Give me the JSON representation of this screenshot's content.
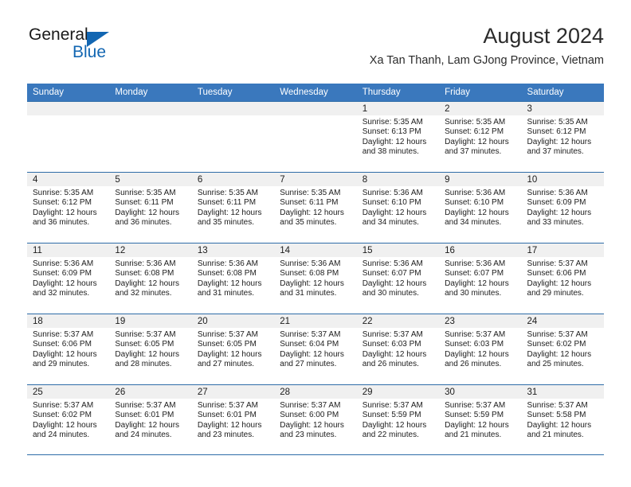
{
  "logo": {
    "primary_text": "General",
    "secondary_text": "Blue",
    "triangle_color": "#1266b2",
    "blue_color": "#1266b2"
  },
  "header": {
    "title": "August 2024",
    "subtitle": "Xa Tan Thanh, Lam GJong Province, Vietnam"
  },
  "theme": {
    "header_bar_color": "#3a78bd",
    "row_border_color": "#2e6da8",
    "day_number_band_color": "#f0f0f0"
  },
  "weekdays": [
    "Sunday",
    "Monday",
    "Tuesday",
    "Wednesday",
    "Thursday",
    "Friday",
    "Saturday"
  ],
  "weeks": [
    [
      {
        "day": "",
        "empty": true
      },
      {
        "day": "",
        "empty": true
      },
      {
        "day": "",
        "empty": true
      },
      {
        "day": "",
        "empty": true
      },
      {
        "day": "1",
        "sunrise": "Sunrise: 5:35 AM",
        "sunset": "Sunset: 6:13 PM",
        "daylight_line1": "Daylight: 12 hours",
        "daylight_line2": "and 38 minutes."
      },
      {
        "day": "2",
        "sunrise": "Sunrise: 5:35 AM",
        "sunset": "Sunset: 6:12 PM",
        "daylight_line1": "Daylight: 12 hours",
        "daylight_line2": "and 37 minutes."
      },
      {
        "day": "3",
        "sunrise": "Sunrise: 5:35 AM",
        "sunset": "Sunset: 6:12 PM",
        "daylight_line1": "Daylight: 12 hours",
        "daylight_line2": "and 37 minutes."
      }
    ],
    [
      {
        "day": "4",
        "sunrise": "Sunrise: 5:35 AM",
        "sunset": "Sunset: 6:12 PM",
        "daylight_line1": "Daylight: 12 hours",
        "daylight_line2": "and 36 minutes."
      },
      {
        "day": "5",
        "sunrise": "Sunrise: 5:35 AM",
        "sunset": "Sunset: 6:11 PM",
        "daylight_line1": "Daylight: 12 hours",
        "daylight_line2": "and 36 minutes."
      },
      {
        "day": "6",
        "sunrise": "Sunrise: 5:35 AM",
        "sunset": "Sunset: 6:11 PM",
        "daylight_line1": "Daylight: 12 hours",
        "daylight_line2": "and 35 minutes."
      },
      {
        "day": "7",
        "sunrise": "Sunrise: 5:35 AM",
        "sunset": "Sunset: 6:11 PM",
        "daylight_line1": "Daylight: 12 hours",
        "daylight_line2": "and 35 minutes."
      },
      {
        "day": "8",
        "sunrise": "Sunrise: 5:36 AM",
        "sunset": "Sunset: 6:10 PM",
        "daylight_line1": "Daylight: 12 hours",
        "daylight_line2": "and 34 minutes."
      },
      {
        "day": "9",
        "sunrise": "Sunrise: 5:36 AM",
        "sunset": "Sunset: 6:10 PM",
        "daylight_line1": "Daylight: 12 hours",
        "daylight_line2": "and 34 minutes."
      },
      {
        "day": "10",
        "sunrise": "Sunrise: 5:36 AM",
        "sunset": "Sunset: 6:09 PM",
        "daylight_line1": "Daylight: 12 hours",
        "daylight_line2": "and 33 minutes."
      }
    ],
    [
      {
        "day": "11",
        "sunrise": "Sunrise: 5:36 AM",
        "sunset": "Sunset: 6:09 PM",
        "daylight_line1": "Daylight: 12 hours",
        "daylight_line2": "and 32 minutes."
      },
      {
        "day": "12",
        "sunrise": "Sunrise: 5:36 AM",
        "sunset": "Sunset: 6:08 PM",
        "daylight_line1": "Daylight: 12 hours",
        "daylight_line2": "and 32 minutes."
      },
      {
        "day": "13",
        "sunrise": "Sunrise: 5:36 AM",
        "sunset": "Sunset: 6:08 PM",
        "daylight_line1": "Daylight: 12 hours",
        "daylight_line2": "and 31 minutes."
      },
      {
        "day": "14",
        "sunrise": "Sunrise: 5:36 AM",
        "sunset": "Sunset: 6:08 PM",
        "daylight_line1": "Daylight: 12 hours",
        "daylight_line2": "and 31 minutes."
      },
      {
        "day": "15",
        "sunrise": "Sunrise: 5:36 AM",
        "sunset": "Sunset: 6:07 PM",
        "daylight_line1": "Daylight: 12 hours",
        "daylight_line2": "and 30 minutes."
      },
      {
        "day": "16",
        "sunrise": "Sunrise: 5:36 AM",
        "sunset": "Sunset: 6:07 PM",
        "daylight_line1": "Daylight: 12 hours",
        "daylight_line2": "and 30 minutes."
      },
      {
        "day": "17",
        "sunrise": "Sunrise: 5:37 AM",
        "sunset": "Sunset: 6:06 PM",
        "daylight_line1": "Daylight: 12 hours",
        "daylight_line2": "and 29 minutes."
      }
    ],
    [
      {
        "day": "18",
        "sunrise": "Sunrise: 5:37 AM",
        "sunset": "Sunset: 6:06 PM",
        "daylight_line1": "Daylight: 12 hours",
        "daylight_line2": "and 29 minutes."
      },
      {
        "day": "19",
        "sunrise": "Sunrise: 5:37 AM",
        "sunset": "Sunset: 6:05 PM",
        "daylight_line1": "Daylight: 12 hours",
        "daylight_line2": "and 28 minutes."
      },
      {
        "day": "20",
        "sunrise": "Sunrise: 5:37 AM",
        "sunset": "Sunset: 6:05 PM",
        "daylight_line1": "Daylight: 12 hours",
        "daylight_line2": "and 27 minutes."
      },
      {
        "day": "21",
        "sunrise": "Sunrise: 5:37 AM",
        "sunset": "Sunset: 6:04 PM",
        "daylight_line1": "Daylight: 12 hours",
        "daylight_line2": "and 27 minutes."
      },
      {
        "day": "22",
        "sunrise": "Sunrise: 5:37 AM",
        "sunset": "Sunset: 6:03 PM",
        "daylight_line1": "Daylight: 12 hours",
        "daylight_line2": "and 26 minutes."
      },
      {
        "day": "23",
        "sunrise": "Sunrise: 5:37 AM",
        "sunset": "Sunset: 6:03 PM",
        "daylight_line1": "Daylight: 12 hours",
        "daylight_line2": "and 26 minutes."
      },
      {
        "day": "24",
        "sunrise": "Sunrise: 5:37 AM",
        "sunset": "Sunset: 6:02 PM",
        "daylight_line1": "Daylight: 12 hours",
        "daylight_line2": "and 25 minutes."
      }
    ],
    [
      {
        "day": "25",
        "sunrise": "Sunrise: 5:37 AM",
        "sunset": "Sunset: 6:02 PM",
        "daylight_line1": "Daylight: 12 hours",
        "daylight_line2": "and 24 minutes."
      },
      {
        "day": "26",
        "sunrise": "Sunrise: 5:37 AM",
        "sunset": "Sunset: 6:01 PM",
        "daylight_line1": "Daylight: 12 hours",
        "daylight_line2": "and 24 minutes."
      },
      {
        "day": "27",
        "sunrise": "Sunrise: 5:37 AM",
        "sunset": "Sunset: 6:01 PM",
        "daylight_line1": "Daylight: 12 hours",
        "daylight_line2": "and 23 minutes."
      },
      {
        "day": "28",
        "sunrise": "Sunrise: 5:37 AM",
        "sunset": "Sunset: 6:00 PM",
        "daylight_line1": "Daylight: 12 hours",
        "daylight_line2": "and 23 minutes."
      },
      {
        "day": "29",
        "sunrise": "Sunrise: 5:37 AM",
        "sunset": "Sunset: 5:59 PM",
        "daylight_line1": "Daylight: 12 hours",
        "daylight_line2": "and 22 minutes."
      },
      {
        "day": "30",
        "sunrise": "Sunrise: 5:37 AM",
        "sunset": "Sunset: 5:59 PM",
        "daylight_line1": "Daylight: 12 hours",
        "daylight_line2": "and 21 minutes."
      },
      {
        "day": "31",
        "sunrise": "Sunrise: 5:37 AM",
        "sunset": "Sunset: 5:58 PM",
        "daylight_line1": "Daylight: 12 hours",
        "daylight_line2": "and 21 minutes."
      }
    ]
  ]
}
